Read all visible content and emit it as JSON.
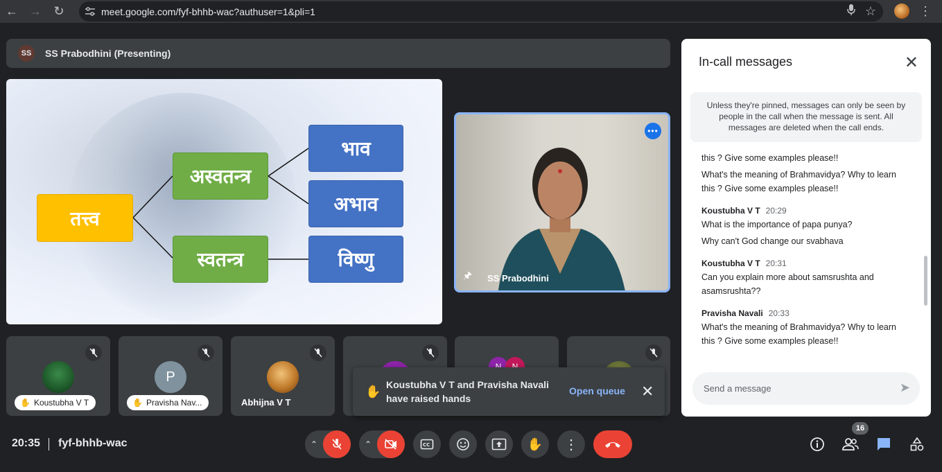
{
  "browser": {
    "url": "meet.google.com/fyf-bhhb-wac?authuser=1&pli=1"
  },
  "presenter_bar": {
    "initials": "SS",
    "label": "SS Prabodhini (Presenting)"
  },
  "slide": {
    "root": "तत्त्व",
    "mid_top": "अस्वतन्त्र",
    "mid_bottom": "स्वतन्त्र",
    "right_1": "भाव",
    "right_2": "अभाव",
    "right_3": "विष्णु"
  },
  "camera": {
    "name": "SS Prabodhini"
  },
  "tiles": [
    {
      "name": "Koustubha V T",
      "initial": ""
    },
    {
      "name": "Pravisha Nav...",
      "initial": "P"
    },
    {
      "name": "Abhijna V T",
      "initial": ""
    },
    {
      "name": "",
      "initial": ""
    },
    {
      "name": "",
      "initial": "N"
    },
    {
      "name": "",
      "initial": ""
    }
  ],
  "toast": {
    "message": "Koustubha V T and Pravisha Navali have raised hands",
    "action": "Open queue"
  },
  "chat": {
    "title": "In-call messages",
    "notice": "Unless they're pinned, messages can only be seen by people in the call when the message is sent. All messages are deleted when the call ends.",
    "m0": "this ? Give some examples please!!",
    "m1": "What's the meaning of Brahmavidya? Why to learn this ? Give some examples please!!",
    "s1_name": "Koustubha V T",
    "s1_time": "20:29",
    "m2": "What is the importance of papa punya?",
    "m3": "Why can't God change our svabhava",
    "s2_name": "Koustubha V T",
    "s2_time": "20:31",
    "m4": "Can you explain more about samsrushta and asamsrushta??",
    "s3_name": "Pravisha Navali",
    "s3_time": "20:33",
    "m5": "What's the meaning of Brahmavidya? Why to learn this ? Give some examples please!!",
    "input_placeholder": "Send a message"
  },
  "bottom": {
    "time": "20:35",
    "meeting_code": "fyf-bhhb-wac",
    "participants_count": "16"
  },
  "colors": {
    "accent_blue": "#8ab4f8",
    "danger_red": "#ea4335",
    "chat_icon_blue": "#8ab4f8"
  }
}
